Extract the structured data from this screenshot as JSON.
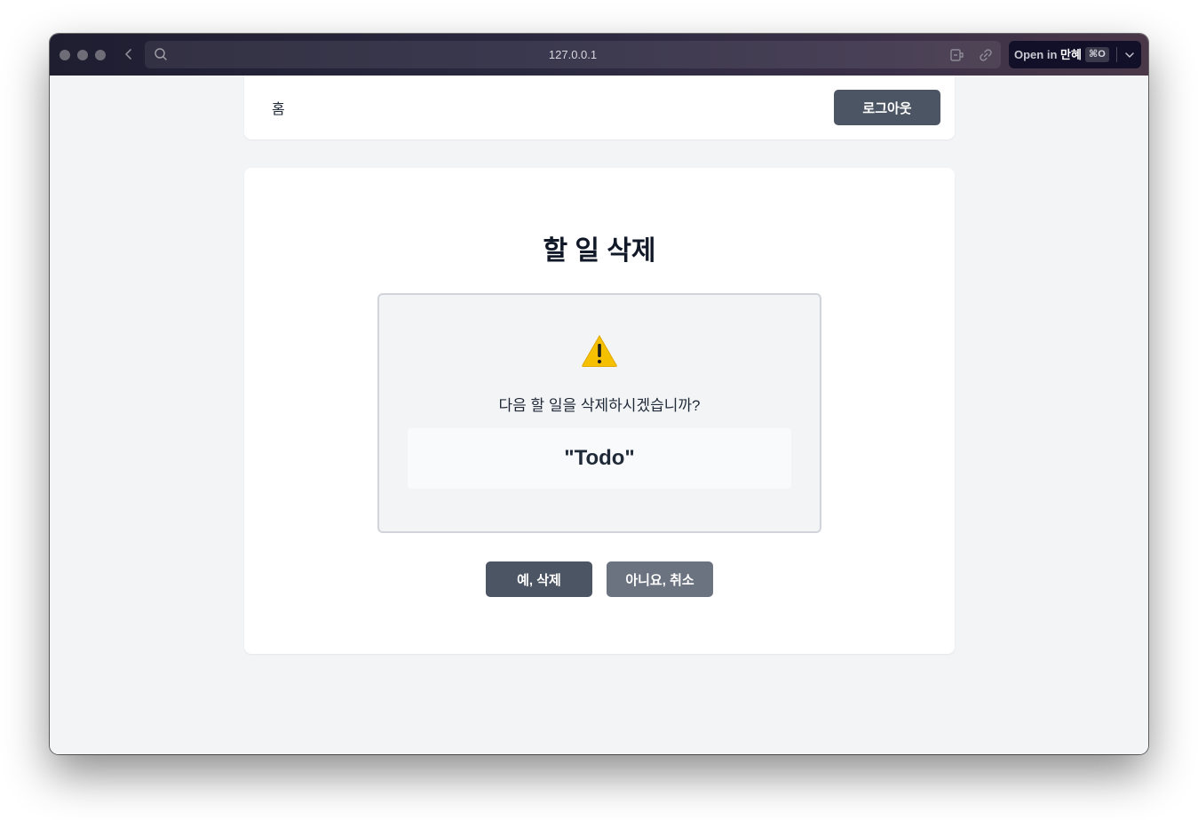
{
  "browser": {
    "url": "127.0.0.1",
    "open_in_prefix": "Open in",
    "open_in_app": "만혜",
    "open_in_shortcut": "⌘O"
  },
  "nav": {
    "home_label": "홈",
    "logout_label": "로그아웃"
  },
  "page": {
    "title": "할 일 삭제",
    "question": "다음 할 일을 삭제하시겠습니까?",
    "todo_name": "\"Todo\"",
    "confirm_label": "예, 삭제",
    "cancel_label": "아니요, 취소"
  },
  "icons": {
    "warning": "warning-icon",
    "search": "search-icon",
    "back": "chevron-left-icon",
    "extension": "extension-icon",
    "link": "link-icon",
    "dropdown": "chevron-down-icon"
  },
  "colors": {
    "primary_button": "#4b5563",
    "secondary_button": "#6b7280",
    "page_background": "#f3f4f6",
    "warning": "#f5c000"
  }
}
